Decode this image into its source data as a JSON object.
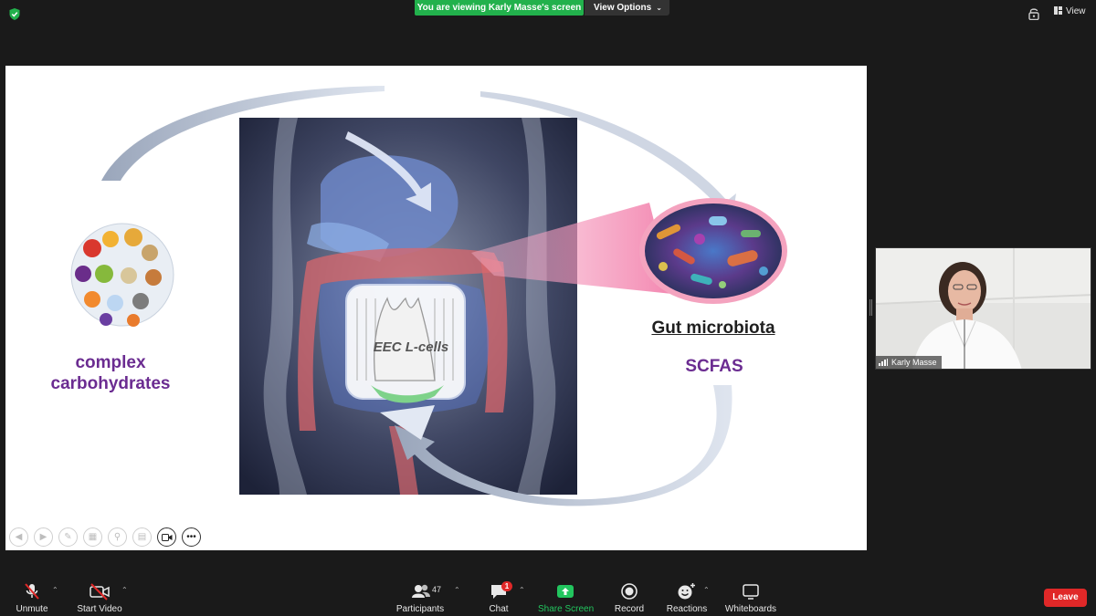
{
  "banner": {
    "viewing_text": "You are viewing Karly Masse's screen",
    "view_options": "View Options"
  },
  "top_right": {
    "view_label": "View"
  },
  "slide": {
    "left_label_line1": "complex",
    "left_label_line2": "carbohydrates",
    "gut_label": "Gut microbiota",
    "scfas_label": "SCFAS",
    "eec_label": "EEC L-cells"
  },
  "participant": {
    "name": "Karly Masse"
  },
  "toolbar": {
    "unmute": "Unmute",
    "start_video": "Start Video",
    "participants": "Participants",
    "participants_count": "47",
    "chat": "Chat",
    "chat_badge": "1",
    "share_screen": "Share Screen",
    "record": "Record",
    "reactions": "Reactions",
    "whiteboards": "Whiteboards",
    "leave": "Leave"
  },
  "colors": {
    "accent_green": "#22b14c",
    "leave_red": "#e02828",
    "label_purple": "#6b2c91"
  }
}
